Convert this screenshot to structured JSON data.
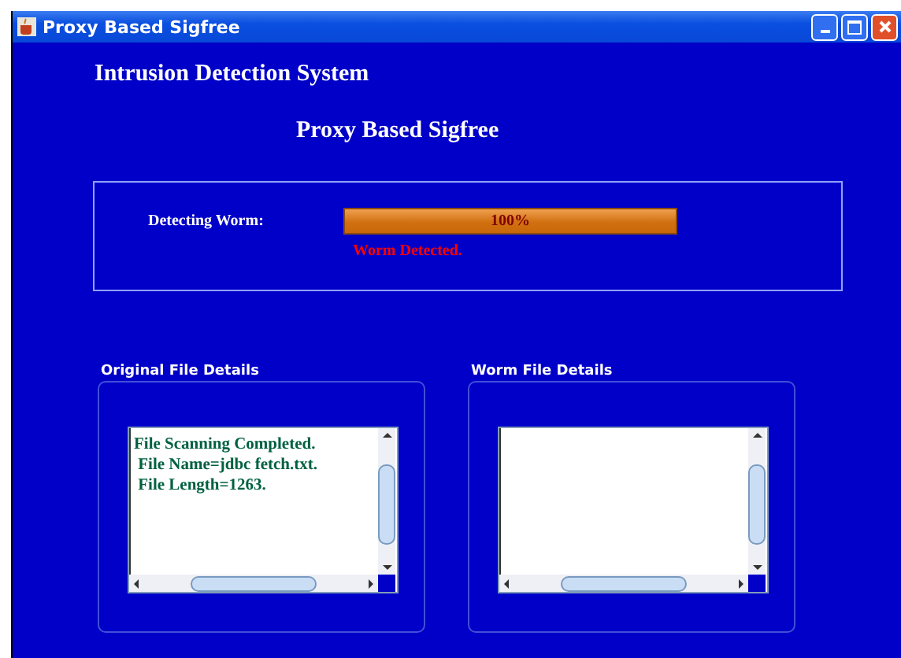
{
  "window": {
    "title": "Proxy Based Sigfree"
  },
  "heading": "Intrusion Detection System",
  "subtitle": "Proxy Based Sigfree",
  "detection": {
    "label": "Detecting Worm:",
    "progress": {
      "level": 1,
      "reading": "100%"
    },
    "status": "Worm Detected."
  },
  "panels": [
    {
      "title": "Original File Details",
      "value": "File Scanning Completed.\n File Name=jdbc fetch.txt.\n File Length=1263."
    },
    {
      "title": "Worm File Details"
    }
  ]
}
